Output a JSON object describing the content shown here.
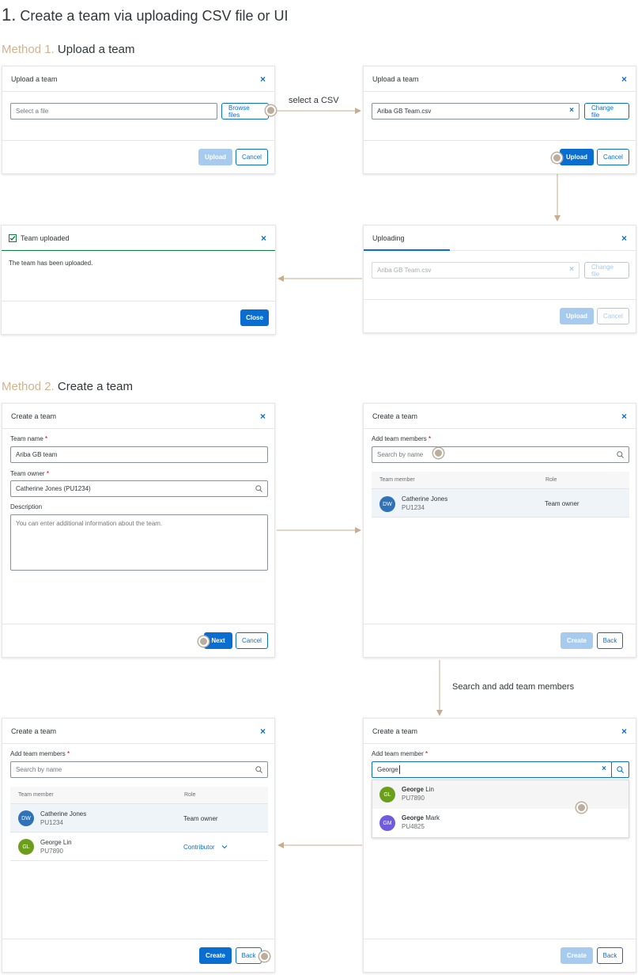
{
  "page": {
    "number": "1.",
    "title": "Create a team via uploading CSV file or UI"
  },
  "method1": {
    "prefix": "Method 1.",
    "label": "Upload a team",
    "annotation_select": "select a CSV",
    "dialog_a": {
      "title": "Upload a team",
      "close": "×",
      "file_placeholder": "Select a file",
      "browse": "Browse files",
      "upload": "Upload",
      "cancel": "Cancel"
    },
    "dialog_b": {
      "title": "Upload a team",
      "close": "×",
      "file_value": "Ariba GB Team.csv",
      "clear": "×",
      "change": "Change file",
      "upload": "Upload",
      "cancel": "Cancel"
    },
    "dialog_c": {
      "title": "Uploading",
      "close": "×",
      "file_value": "Ariba GB Team.csv",
      "clear": "×",
      "change": "Change file",
      "upload": "Upload",
      "cancel": "Cancel",
      "progress": 0.3
    },
    "dialog_d": {
      "title": "Team uploaded",
      "close": "×",
      "message": "The team has been uploaded.",
      "close_button": "Close",
      "status_color": "#107e3e"
    }
  },
  "method2": {
    "prefix": "Method 2.",
    "label": "Create a team",
    "annotation_search": "Search and add team members",
    "dialog_e": {
      "title": "Create a team",
      "close": "×",
      "team_name_label": "Team name",
      "team_name_value": "Ariba GB team",
      "owner_label": "Team owner",
      "owner_value": "Catherine Jones (PU1234)",
      "description_label": "Description",
      "description_placeholder": "You can enter additional information about the team.",
      "next": "Next",
      "cancel": "Cancel"
    },
    "dialog_f": {
      "title": "Create a team",
      "close": "×",
      "members_label": "Add team members",
      "search_placeholder": "Search by name",
      "col_member": "Team member",
      "col_role": "Role",
      "rows": [
        {
          "initials": "DW",
          "name": "Catherine Jones",
          "id": "PU1234",
          "role": "Team owner",
          "color": "#2f72b8"
        }
      ],
      "create": "Create",
      "back": "Back"
    },
    "dialog_g": {
      "title": "Create a team",
      "close": "×",
      "members_label": "Add team members",
      "search_placeholder": "Search by name",
      "col_member": "Team member",
      "col_role": "Role",
      "rows": [
        {
          "initials": "DW",
          "name": "Catherine Jones",
          "id": "PU1234",
          "role": "Team owner",
          "color": "#2f72b8"
        },
        {
          "initials": "GL",
          "name": "George Lin",
          "id": "PU7890",
          "role": "Contributor",
          "color": "#6b9e1a"
        }
      ],
      "create": "Create",
      "back": "Back"
    },
    "dialog_h": {
      "title": "Create a team",
      "close": "×",
      "member_label": "Add team member",
      "search_value": "George",
      "clear": "×",
      "suggestions": [
        {
          "initials": "GL",
          "bold": "George",
          "rest": " Lin",
          "id": "PU7890",
          "color": "#6b9e1a"
        },
        {
          "initials": "GM",
          "bold": "George",
          "rest": " Mark",
          "id": "PU4825",
          "color": "#6e5be0"
        }
      ],
      "create": "Create",
      "back": "Back"
    }
  },
  "icons": {
    "close": "close-icon",
    "search": "search-icon",
    "checkbox": "checkbox-checked-icon",
    "chevron": "chevron-down-icon"
  },
  "colors": {
    "brand": "#0a6ed1",
    "accent_annotation": "#c9ad8e"
  }
}
